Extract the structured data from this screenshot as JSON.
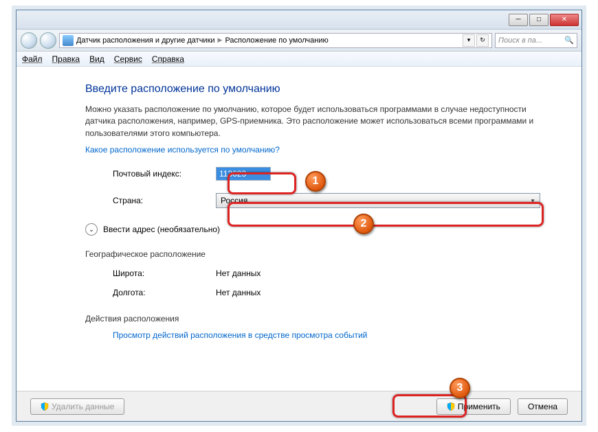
{
  "breadcrumb": {
    "item1": "Датчик расположения и другие датчики",
    "item2": "Расположение по умолчанию"
  },
  "search": {
    "placeholder": "Поиск в па..."
  },
  "menu": {
    "file": "Файл",
    "edit": "Правка",
    "view": "Вид",
    "tools": "Сервис",
    "help": "Справка"
  },
  "page": {
    "heading": "Введите расположение по умолчанию",
    "desc": "Можно указать расположение по умолчанию, которое будет использоваться программами в случае недоступности датчика расположения, например, GPS-приемника. Это расположение может использоваться всеми программами и пользователями этого компьютера.",
    "help_link": "Какое расположение используется по умолчанию?"
  },
  "form": {
    "postal_label": "Почтовый индекс:",
    "postal_value": "113623",
    "country_label": "Страна:",
    "country_value": "Россия",
    "expand_label": "Ввести адрес (необязательно)",
    "geo_heading": "Географическое расположение",
    "lat_label": "Широта:",
    "lat_value": "Нет данных",
    "lon_label": "Долгота:",
    "lon_value": "Нет данных",
    "actions_heading": "Действия расположения",
    "actions_link": "Просмотр действий расположения в средстве просмотра событий"
  },
  "buttons": {
    "delete": "Удалить данные",
    "apply": "Применить",
    "cancel": "Отмена"
  },
  "callouts": {
    "n1": "1",
    "n2": "2",
    "n3": "3"
  }
}
